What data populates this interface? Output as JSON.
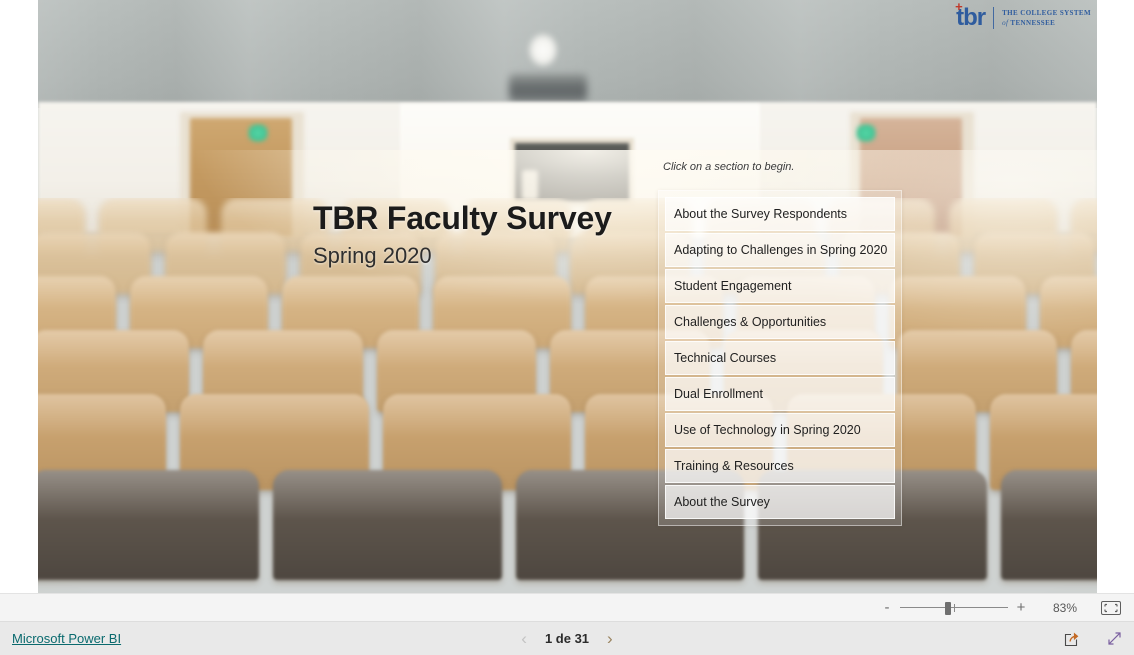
{
  "report": {
    "title": "TBR Faculty Survey",
    "subtitle": "Spring 2020",
    "hint": "Click on a section to begin."
  },
  "logo": {
    "mark": "tbr",
    "cross": "+",
    "line1": "THE COLLEGE SYSTEM",
    "line2_prefix": "of",
    "line2": "TENNESSEE"
  },
  "nav": {
    "items": [
      {
        "label": "About the Survey Respondents"
      },
      {
        "label": "Adapting to Challenges in Spring 2020"
      },
      {
        "label": "Student Engagement"
      },
      {
        "label": "Challenges & Opportunities"
      },
      {
        "label": "Technical Courses"
      },
      {
        "label": "Dual Enrollment"
      },
      {
        "label": "Use of Technology in Spring 2020"
      },
      {
        "label": "Training & Resources"
      },
      {
        "label": "About the Survey"
      }
    ]
  },
  "zoom_bar": {
    "minus_label": "-",
    "plus_label": "+",
    "value": "83%",
    "fit_icon": "fit-to-page-icon"
  },
  "status_bar": {
    "powerbi_label": "Microsoft Power BI",
    "prev_arrow": "‹",
    "next_arrow": "›",
    "page_label": "1 de 31",
    "share_icon": "share-icon",
    "fullscreen_icon": "fullscreen-icon"
  },
  "colors": {
    "link": "#0a6a6e",
    "logo_blue": "#2f5c9e",
    "logo_red": "#c0392b",
    "status_bg": "#e9e9e9"
  }
}
